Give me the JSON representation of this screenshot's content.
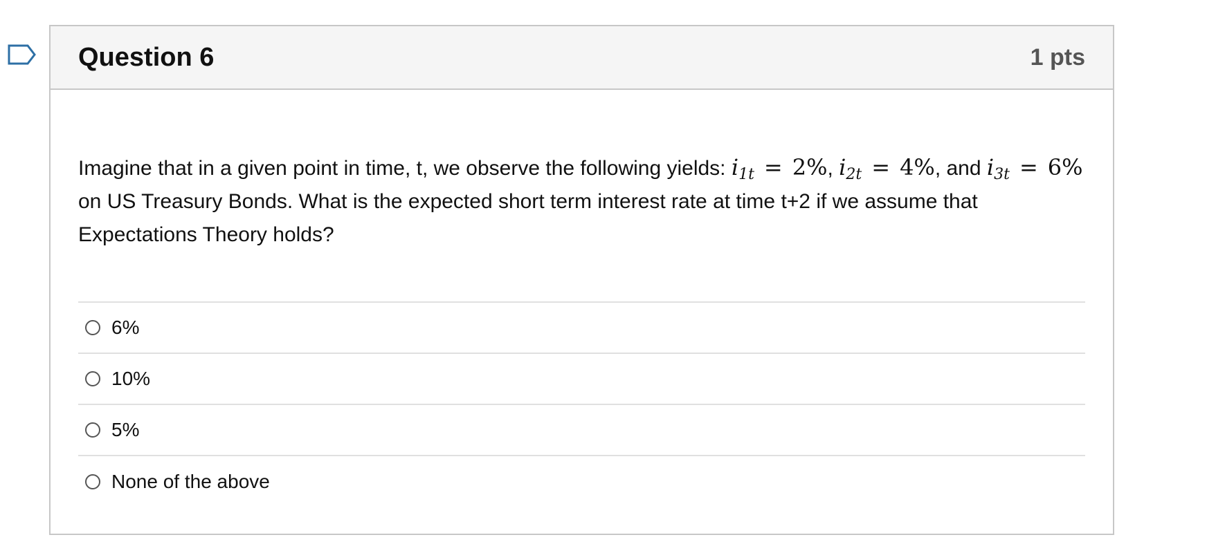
{
  "question": {
    "title": "Question 6",
    "points": "1 pts",
    "text": {
      "part1": "Imagine that in a given point in time, t, we observe the following yields: ",
      "math1": {
        "var": "i",
        "sub": "1t",
        "eq": "=",
        "value": "2%"
      },
      "sep1": ", ",
      "math2": {
        "var": "i",
        "sub": "2t",
        "eq": "=",
        "value": "4%"
      },
      "part2": ", and ",
      "math3": {
        "var": "i",
        "sub": "3t",
        "eq": "=",
        "value": "6%"
      },
      "part3": " on US Treasury Bonds.  What is the expected short term interest rate at time t+2 if we assume that Expectations Theory holds?"
    },
    "answers": [
      {
        "label": "6%"
      },
      {
        "label": "10%"
      },
      {
        "label": "5%"
      },
      {
        "label": "None of the above"
      }
    ]
  },
  "icons": {
    "flag": "bookmark-flag-icon",
    "radio": "radio-button-icon"
  },
  "colors": {
    "flag_stroke": "#2d6fa5",
    "header_bg": "#f5f5f5",
    "border": "#c7c7c7",
    "points_text": "#555555"
  }
}
